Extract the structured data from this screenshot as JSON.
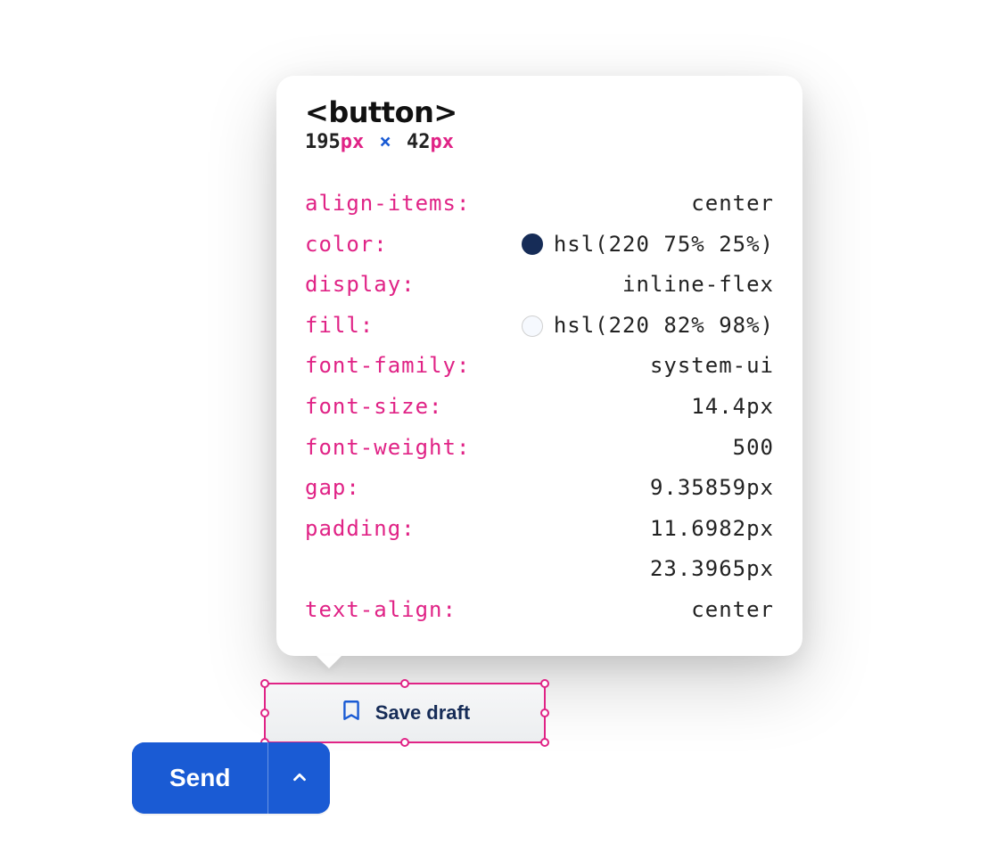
{
  "inspector": {
    "element": "<button>",
    "dimensions": {
      "width": "195",
      "height": "42",
      "unit": "px",
      "separator": "×"
    },
    "properties": [
      {
        "name": "align-items",
        "value": "center"
      },
      {
        "name": "color",
        "value": "hsl(220 75% 25%)",
        "swatchStyle": "background:#162c57;border-color:#162c57"
      },
      {
        "name": "display",
        "value": "inline-flex"
      },
      {
        "name": "fill",
        "value": "hsl(220 82% 98%)",
        "swatchStyle": "background:#f6f9fe"
      },
      {
        "name": "font-family",
        "value": "system-ui"
      },
      {
        "name": "font-size",
        "value": "14.4px"
      },
      {
        "name": "font-weight",
        "value": "500"
      },
      {
        "name": "gap",
        "value": "9.35859px"
      },
      {
        "name": "padding",
        "valueLines": [
          "11.6982px",
          "23.3965px"
        ]
      },
      {
        "name": "text-align",
        "value": "center"
      }
    ]
  },
  "buttons": {
    "saveDraft": {
      "label": "Save draft"
    },
    "send": {
      "label": "Send"
    }
  }
}
